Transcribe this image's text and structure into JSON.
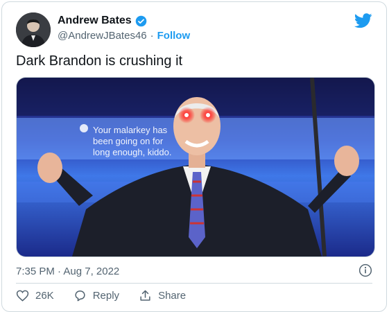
{
  "author": {
    "display_name": "Andrew Bates",
    "handle": "@AndrewJBates46",
    "separator": "·",
    "follow_label": "Follow"
  },
  "tweet": {
    "text": "Dark Brandon is crushing it",
    "image_caption_line1": "Your malarkey has",
    "image_caption_line2": "been going on for",
    "image_caption_line3": "long enough, kiddo.",
    "timestamp": "7:35 PM · Aug 7, 2022"
  },
  "actions": {
    "likes_count": "26K",
    "reply_label": "Reply",
    "share_label": "Share"
  },
  "icons": {
    "verified": "verified-badge-icon",
    "logo": "twitter-bird-icon",
    "info": "info-icon",
    "like": "heart-icon",
    "reply": "reply-bubble-icon",
    "share": "share-icon"
  },
  "colors": {
    "accent": "#1d9bf0",
    "text": "#0f1419",
    "secondary": "#536471",
    "border": "#cfd9de"
  }
}
